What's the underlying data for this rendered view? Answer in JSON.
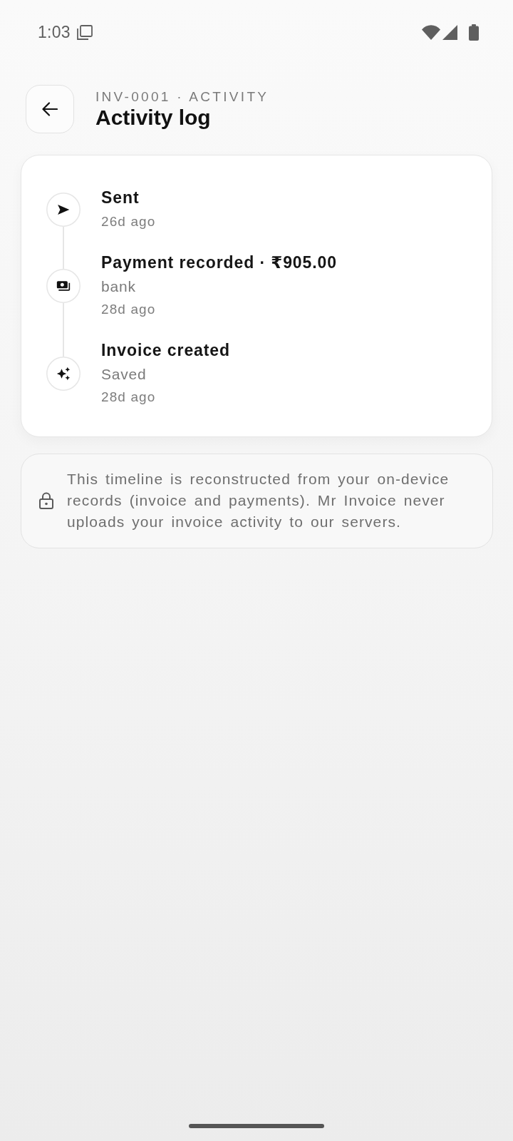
{
  "status_bar": {
    "time": "1:03"
  },
  "header": {
    "eyebrow": "INV-0001 · ACTIVITY",
    "title": "Activity log"
  },
  "timeline": [
    {
      "kind": "sent",
      "title": "Sent",
      "time": "26d ago"
    },
    {
      "kind": "payment",
      "title": "Payment recorded · ₹905.00",
      "note": "bank",
      "time": "28d ago"
    },
    {
      "kind": "created",
      "title": "Invoice created",
      "note": "Saved",
      "time": "28d ago"
    }
  ],
  "privacy_note": {
    "text": "This timeline is reconstructed from your on-device records (invoice and payments). Mr Invoice never uploads your invoice activity to our servers."
  }
}
